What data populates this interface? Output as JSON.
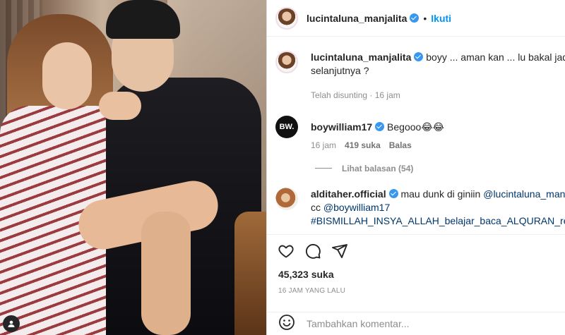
{
  "post": {
    "username": "lucintaluna_manjalita",
    "follow_label": "Ikuti",
    "dot": "•"
  },
  "comments": [
    {
      "username": "lucintaluna_manjalita",
      "text_line1": "boyy ... aman kan ... lu bakal jadi ca",
      "text_line2": "selanjutnya ?",
      "meta_time": "Telah disunting · 16 jam"
    },
    {
      "username": "boywilliam17",
      "avatar_text": "BW.",
      "text": "Begooo😂😂",
      "meta_time": "16 jam",
      "meta_likes": "419 suka",
      "reply_label": "Balas",
      "view_replies": "Lihat balasan (54)"
    },
    {
      "username": "alditaher.official",
      "text_line1_plain": "mau dunk di giniin ",
      "text_line1_mention": "@lucintaluna_manjali",
      "text_line2_plain": "cc ",
      "text_line2_mention": "@boywilliam17",
      "text_line3_hashtag": "#BISMILLAH_INSYA_ALLAH_belajar_baca_ALQURAN_rekam_p"
    }
  ],
  "actions": {
    "likes": "45,323 suka",
    "time": "16 JAM YANG LALU"
  },
  "composer": {
    "placeholder": "Tambahkan komentar..."
  },
  "icons": [
    "heart-icon",
    "comment-icon",
    "share-icon",
    "emoji-icon",
    "user-tag-icon",
    "verified-badge-icon"
  ],
  "colors": {
    "accent": "#0095f6",
    "verified": "#3897f0",
    "muted": "#8e8e8e",
    "link": "#00376b"
  }
}
